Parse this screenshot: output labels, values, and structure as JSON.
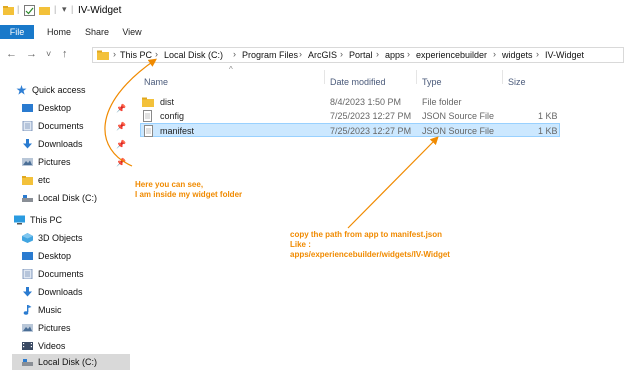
{
  "window": {
    "title": "IV-Widget",
    "titlebar_sep": "|",
    "dropdown_glyph": "▾"
  },
  "ribbon": {
    "tabs": [
      "File",
      "Home",
      "Share",
      "View"
    ]
  },
  "nav": {
    "back": "←",
    "forward": "→",
    "recent": "˅",
    "up": "↑",
    "breadcrumb": [
      "This PC",
      "Local Disk (C:)",
      "Program Files",
      "ArcGIS",
      "Portal",
      "apps",
      "experiencebuilder",
      "widgets",
      "IV-Widget"
    ],
    "separator": "›"
  },
  "sidebar": {
    "items": [
      {
        "label": "Quick access",
        "icon": "star-icon",
        "pinned": false
      },
      {
        "label": "Desktop",
        "icon": "desktop-icon",
        "pinned": true
      },
      {
        "label": "Documents",
        "icon": "documents-icon",
        "pinned": true
      },
      {
        "label": "Downloads",
        "icon": "downloads-icon",
        "pinned": true
      },
      {
        "label": "Pictures",
        "icon": "pictures-icon",
        "pinned": true
      },
      {
        "label": "etc",
        "icon": "folder-icon",
        "pinned": false
      },
      {
        "label": "Local Disk (C:)",
        "icon": "drive-icon",
        "pinned": false
      },
      {
        "label": "This PC",
        "icon": "computer-icon",
        "pinned": false
      },
      {
        "label": "3D Objects",
        "icon": "3d-objects-icon",
        "pinned": false
      },
      {
        "label": "Desktop",
        "icon": "desktop-icon",
        "pinned": false
      },
      {
        "label": "Documents",
        "icon": "documents-icon",
        "pinned": false
      },
      {
        "label": "Downloads",
        "icon": "downloads-icon",
        "pinned": false
      },
      {
        "label": "Music",
        "icon": "music-icon",
        "pinned": false
      },
      {
        "label": "Pictures",
        "icon": "pictures-icon",
        "pinned": false
      },
      {
        "label": "Videos",
        "icon": "videos-icon",
        "pinned": false
      },
      {
        "label": "Local Disk (C:)",
        "icon": "drive-icon",
        "pinned": false,
        "selected": true
      }
    ],
    "pin_glyph": "📌"
  },
  "file_list": {
    "sort_glyph": "^",
    "columns": [
      "Name",
      "Date modified",
      "Type",
      "Size"
    ],
    "rows": [
      {
        "name": "dist",
        "date": "8/4/2023 1:50 PM",
        "type": "File folder",
        "size": "",
        "icon": "folder-icon"
      },
      {
        "name": "config",
        "date": "7/25/2023 12:27 PM",
        "type": "JSON Source File",
        "size": "1 KB",
        "icon": "json-file-icon"
      },
      {
        "name": "manifest",
        "date": "7/25/2023 12:27 PM",
        "type": "JSON Source File",
        "size": "1 KB",
        "icon": "json-file-icon",
        "selected": true
      }
    ]
  },
  "annotations": {
    "left_note": [
      "Here you can see,",
      "I am inside my widget folder"
    ],
    "right_note": [
      "copy the path from app to manifest.json",
      "Like :",
      "apps/experiencebuilder/widgets/IV-Widget"
    ]
  },
  "colors": {
    "accent": "#1979ca",
    "annotation": "#f08a00",
    "folder": "#f3c13a",
    "selection": "#cce8ff"
  }
}
